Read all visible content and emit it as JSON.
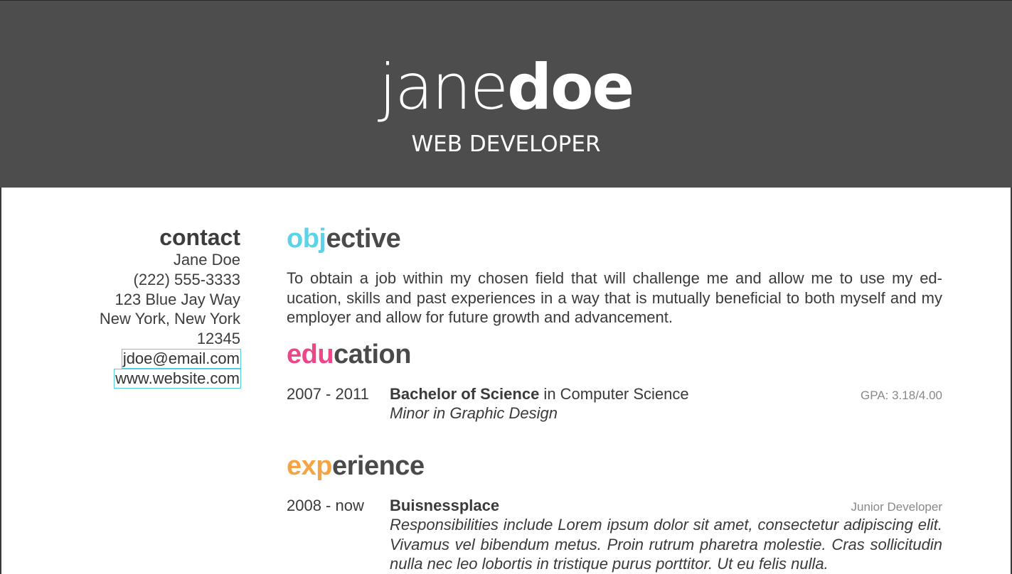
{
  "header": {
    "first_name": "jane",
    "last_name": "doe",
    "job_title": "WEB DEVELOPER"
  },
  "contact": {
    "heading": "contact",
    "name": "Jane Doe",
    "phone": "(222) 555-3333",
    "street": "123 Blue Jay Way",
    "city": "New York, New York",
    "zip": "12345",
    "email": "jdoe@email.com",
    "website": "www.website.com"
  },
  "objective": {
    "heading_accent": "obj",
    "heading_rest": "ective",
    "text": "To obtain a job within my chosen field that will challenge me and allow me to use my ed­ucation, skills and past experiences in a way that is mutually beneficial to both myself and my employer and allow for future growth and advancement."
  },
  "education": {
    "heading_accent": "edu",
    "heading_rest": "cation",
    "entries": [
      {
        "dates": "2007 - 2011",
        "degree": "Bachelor of Science",
        "field": " in Computer Science",
        "minor": "Minor in Graphic Design",
        "gpa": "GPA: 3.18/4.00"
      }
    ]
  },
  "experience": {
    "heading_accent": "exp",
    "heading_rest": "erience",
    "entries": [
      {
        "dates": "2008 - now",
        "company": "Buisnessplace",
        "role": "Junior Developer",
        "description": "Responsibilities include Lorem ipsum dolor sit amet, consectetur adipiscing elit.  Vivamus vel bibendum metus.  Proin rutrum pharetra molestie.  Cras sollicitudin nulla nec leo lobortis in tristique purus porttitor. Ut eu felis nulla."
      }
    ]
  },
  "colors": {
    "header_bg": "#4d4d4d",
    "objective_accent": "#5bd3e8",
    "education_accent": "#ee4688",
    "experience_accent": "#f5a343"
  }
}
